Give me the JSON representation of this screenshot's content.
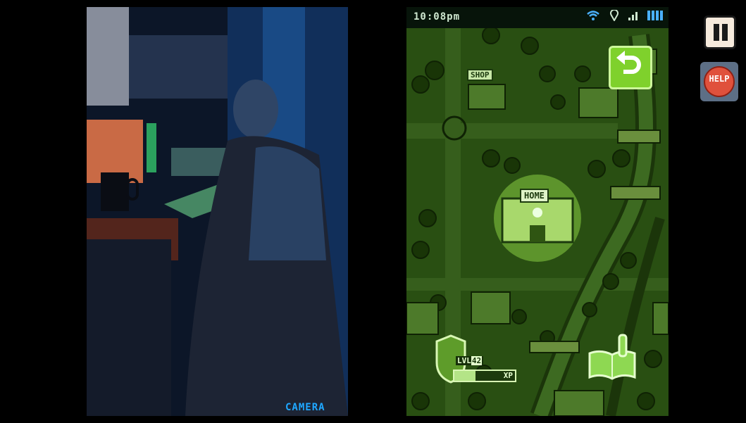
{
  "camera": {
    "label": "CAMERA"
  },
  "status_bar": {
    "time": "10:08pm",
    "icons": [
      "wifi-icon",
      "location-icon",
      "signal-icon",
      "battery-icon"
    ]
  },
  "map": {
    "home_label": "HOME",
    "shop_label": "SHOP"
  },
  "player": {
    "level_label": "LVL",
    "level": "42",
    "xp_label": "XP",
    "xp_progress": 0.35
  },
  "controls": {
    "help_label": "HELP",
    "pause_icon": "pause-icon",
    "back_icon": "back-arrow-icon",
    "journal_icon": "journal-book-icon"
  },
  "colors": {
    "map_green": "#294f12",
    "camera_label": "#1fa7ff",
    "help_red": "#e0513c",
    "back_button": "#7fd12c"
  }
}
